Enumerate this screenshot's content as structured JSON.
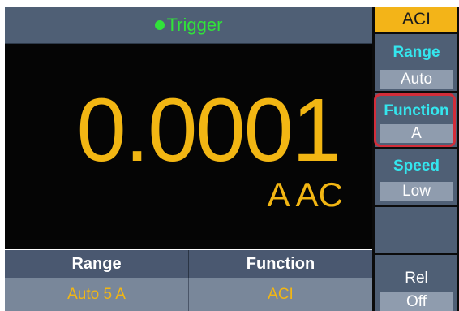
{
  "header": {
    "trigger_label": "Trigger"
  },
  "display": {
    "reading": "0.0001",
    "unit": "A AC"
  },
  "bottom_bar": {
    "headers": [
      "Range",
      "Function"
    ],
    "values": [
      "Auto 5 A",
      "ACI"
    ]
  },
  "menu": {
    "title": "ACI",
    "range_label": "Range",
    "range_value": "Auto",
    "function_label": "Function",
    "function_value": "A",
    "speed_label": "Speed",
    "speed_value": "Low",
    "rel_label": "Rel",
    "rel_value": "Off"
  },
  "colors": {
    "reading": "#f2b613",
    "trigger": "#31e23a",
    "menu_label": "#34e6ee",
    "menu_title_bg": "#f3b418",
    "highlight": "#d22d3a"
  }
}
